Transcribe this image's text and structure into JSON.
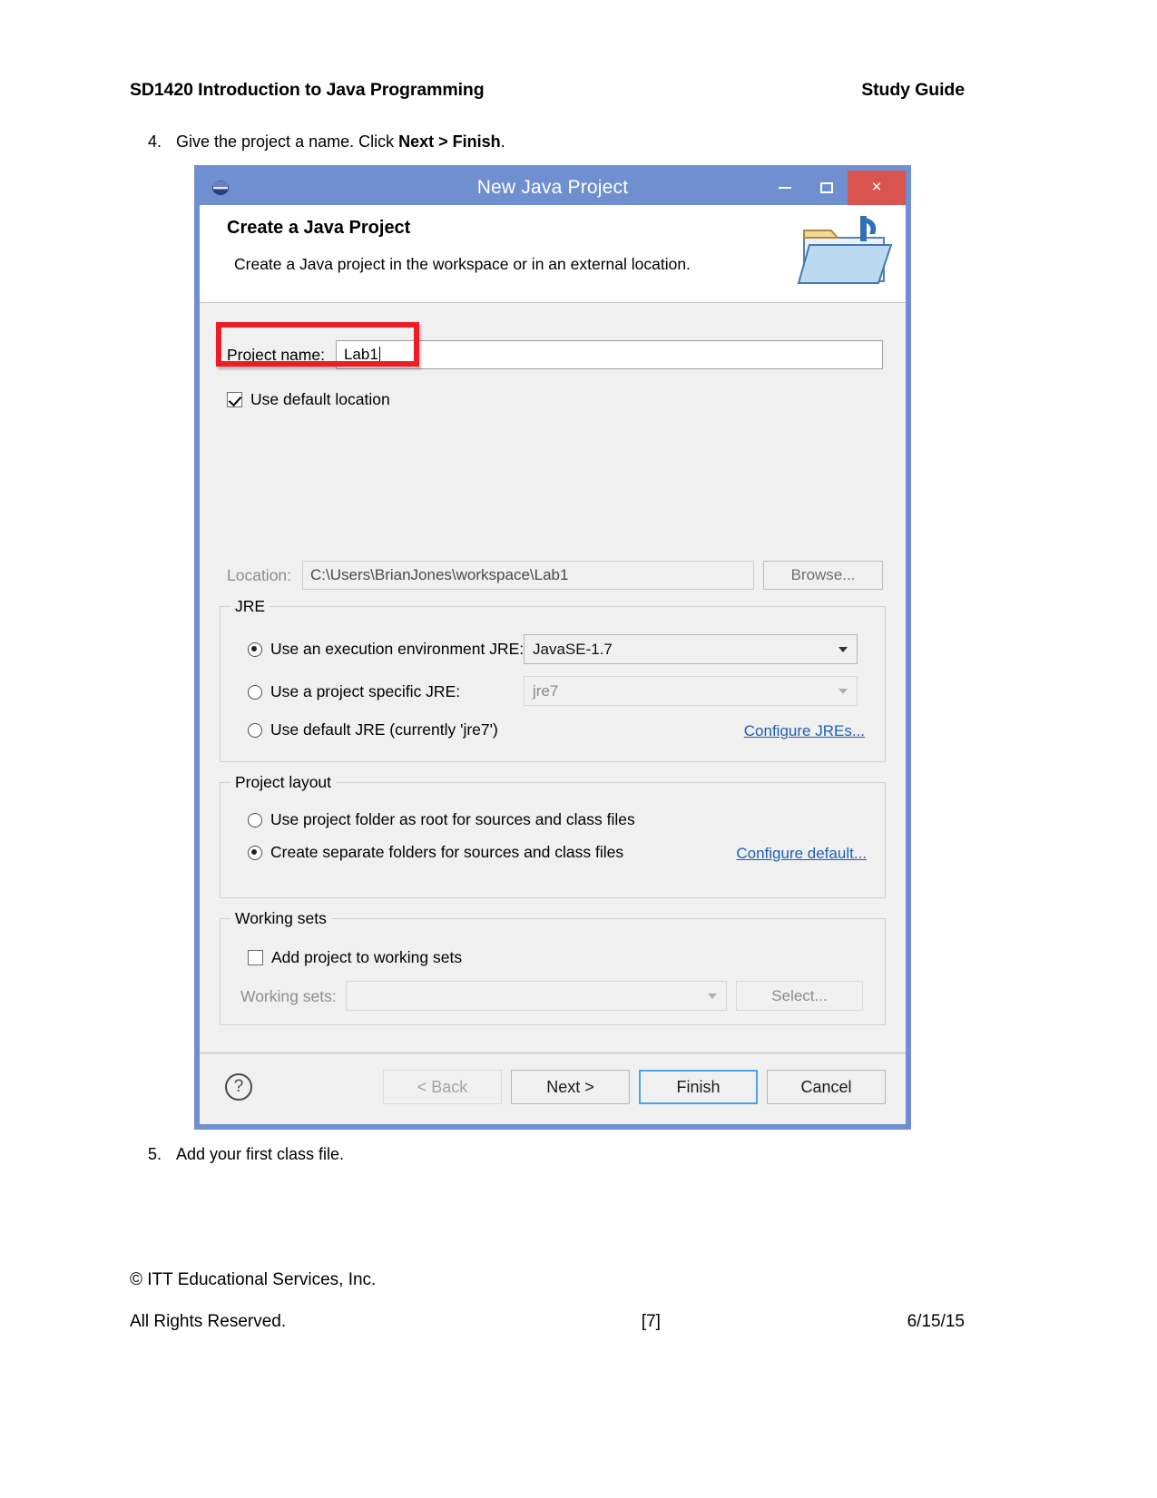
{
  "document": {
    "header": {
      "course_title": "SD1420 Introduction to Java Programming",
      "doc_type": "Study Guide"
    },
    "steps": [
      {
        "number": "4.",
        "text_before": "Give the project a name. Click ",
        "bold_1": "Next",
        "text_mid": " > ",
        "bold_2": "Finish",
        "text_after": "."
      },
      {
        "number": "5.",
        "text": "Add your first class file."
      }
    ],
    "footer": {
      "copyright": "© ITT Educational Services, Inc.",
      "rights": "All Rights Reserved.",
      "page_number": "[7]",
      "date": "6/15/15"
    }
  },
  "dialog": {
    "titlebar": {
      "title": "New Java Project",
      "app_icon": "eclipse-icon",
      "minimize": "–",
      "maximize": "□",
      "close": "×"
    },
    "header": {
      "heading": "Create a Java Project",
      "description": "Create a Java project in the workspace or in an external location.",
      "icon": "java-project-folder-icon"
    },
    "project_name": {
      "label": "Project name:",
      "value": "Lab1",
      "highlighted": true,
      "highlight_color": "#ee1c25"
    },
    "use_default_location": {
      "label": "Use default location",
      "checked": true
    },
    "location": {
      "label": "Location:",
      "value": "C:\\Users\\BrianJones\\workspace\\Lab1",
      "browse_label": "Browse...",
      "disabled": true
    },
    "jre_group": {
      "legend": "JRE",
      "options": [
        {
          "label": "Use an execution environment JRE:",
          "selected": true,
          "combo_value": "JavaSE-1.7",
          "combo_disabled": false
        },
        {
          "label": "Use a project specific JRE:",
          "selected": false,
          "combo_value": "jre7",
          "combo_disabled": true
        },
        {
          "label": "Use default JRE (currently 'jre7')",
          "selected": false
        }
      ],
      "link": "Configure JREs..."
    },
    "layout_group": {
      "legend": "Project layout",
      "options": [
        {
          "label": "Use project folder as root for sources and class files",
          "selected": false
        },
        {
          "label": "Create separate folders for sources and class files",
          "selected": true
        }
      ],
      "link": "Configure default..."
    },
    "working_sets_group": {
      "legend": "Working sets",
      "checkbox_label": "Add project to working sets",
      "checkbox_checked": false,
      "combo_label": "Working sets:",
      "combo_value": "",
      "select_label": "Select...",
      "disabled": true
    },
    "footer": {
      "help_glyph": "?",
      "buttons": [
        {
          "label": "< Back",
          "state": "disabled"
        },
        {
          "label": "Next >",
          "state": "enabled"
        },
        {
          "label": "Finish",
          "state": "default"
        },
        {
          "label": "Cancel",
          "state": "enabled"
        }
      ]
    }
  },
  "colors": {
    "title_bar": "#6f8fd0",
    "close_button": "#d9534f",
    "highlight": "#ee1c25",
    "link": "#1d5fb4",
    "default_button_border": "#4ea3e8",
    "dialog_bg": "#f0f0f0"
  }
}
